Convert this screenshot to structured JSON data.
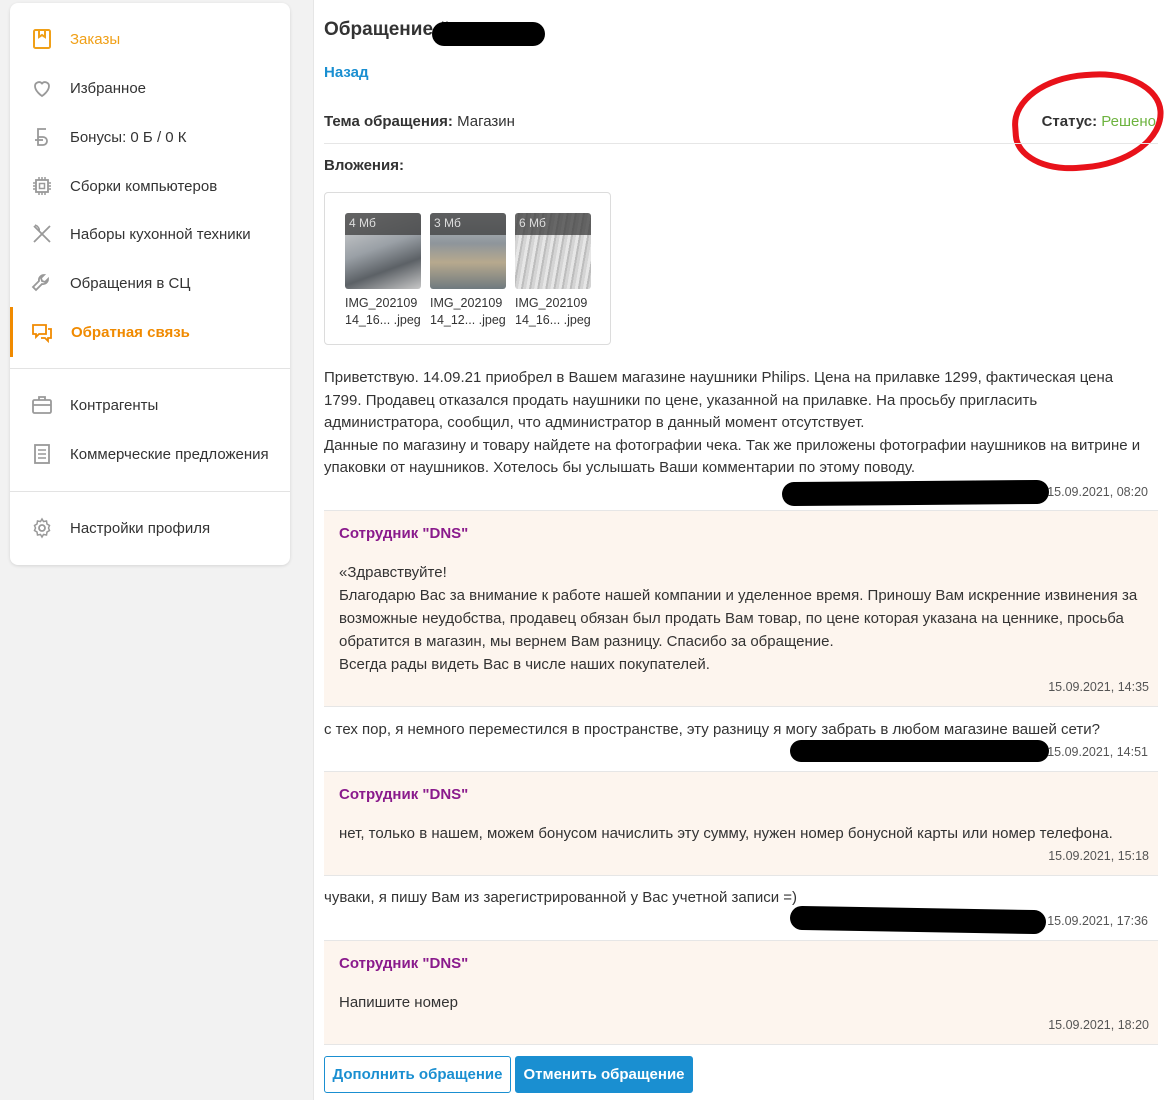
{
  "sidebar": {
    "items": [
      {
        "label": "Заказы",
        "icon": "orders-icon"
      },
      {
        "label": "Избранное",
        "icon": "heart-icon"
      },
      {
        "label": "Бонусы: 0 Б / 0 К",
        "icon": "bonus-icon"
      },
      {
        "label": "Сборки компьютеров",
        "icon": "chip-icon"
      },
      {
        "label": "Наборы кухонной техники",
        "icon": "cutlery-icon"
      },
      {
        "label": "Обращения в СЦ",
        "icon": "wrench-icon"
      },
      {
        "label": "Обратная связь",
        "icon": "chat-icon"
      },
      {
        "label": "Контрагенты",
        "icon": "briefcase-icon"
      },
      {
        "label": "Коммерческие предложения",
        "icon": "document-icon"
      },
      {
        "label": "Настройки профиля",
        "icon": "gear-icon"
      }
    ]
  },
  "main": {
    "title": "Обращение #",
    "back_label": "Назад",
    "topic_label": "Тема обращения:",
    "topic_value": "Магазин",
    "status_label": "Статус:",
    "status_value": "Решено",
    "status_color": "#6db33f",
    "attachments_label": "Вложения:",
    "attachments": [
      {
        "size": "4 Мб",
        "name1": "IMG_202109",
        "name2": "14_16... .jpeg"
      },
      {
        "size": "3 Мб",
        "name1": "IMG_202109",
        "name2": "14_12... .jpeg"
      },
      {
        "size": "6 Мб",
        "name1": "IMG_202109",
        "name2": "14_16... .jpeg"
      }
    ],
    "messages": [
      {
        "author": "",
        "lines": [
          "Приветствую. 14.09.21 приобрел в Вашем магазине наушники Philips. Цена на прилавке 1299, фактическая цена",
          "1799. Продавец отказался продать наушники по цене, указанной на прилавке. На просьбу пригласить",
          "администратора, сообщил, что администратор в данный момент отсутствует.",
          "Данные по магазину и товару найдете на фотографии чека. Так же приложены фотографии наушников на витрине и",
          "упаковки от наушников. Хотелось бы услышать Ваши комментарии по этому поводу."
        ],
        "time": "15.09.2021, 08:20"
      },
      {
        "author": "Сотрудник \"DNS\"",
        "lines": [
          "«Здравствуйте!",
          "Благодарю Вас за внимание к работе нашей компании и уделенное время. Приношу Вам искренние извинения за",
          "возможные неудобства, продавец обязан был продать Вам товар, по цене которая указана на ценнике, просьба",
          "обратится в магазин, мы вернем Вам разницу. Спасибо за обращение.",
          "Всегда рады видеть Вас в числе наших покупателей."
        ],
        "time": "15.09.2021, 14:35"
      },
      {
        "author": "",
        "lines": [
          "с тех пор, я немного переместился в пространстве, эту разницу я могу забрать в любом магазине вашей сети?"
        ],
        "time": "15.09.2021, 14:51"
      },
      {
        "author": "Сотрудник \"DNS\"",
        "lines": [
          "нет, только в нашем, можем бонусом начислить эту сумму, нужен номер бонусной карты или номер телефона."
        ],
        "time": "15.09.2021, 15:18"
      },
      {
        "author": "",
        "lines": [
          "чуваки, я пишу Вам из зарегистрированной у Вас учетной записи =)"
        ],
        "time": "15.09.2021, 17:36"
      },
      {
        "author": "Сотрудник \"DNS\"",
        "lines": [
          "Напишите номер"
        ],
        "time": "15.09.2021, 18:20"
      }
    ],
    "buttons": {
      "supplement": "Дополнить обращение",
      "cancel": "Отменить обращение"
    },
    "colors": {
      "accent_orange": "#f08a00",
      "link_blue": "#1a8fd1",
      "staff_purple": "#8a1a8c",
      "staff_bg": "#fdf5ee"
    }
  }
}
